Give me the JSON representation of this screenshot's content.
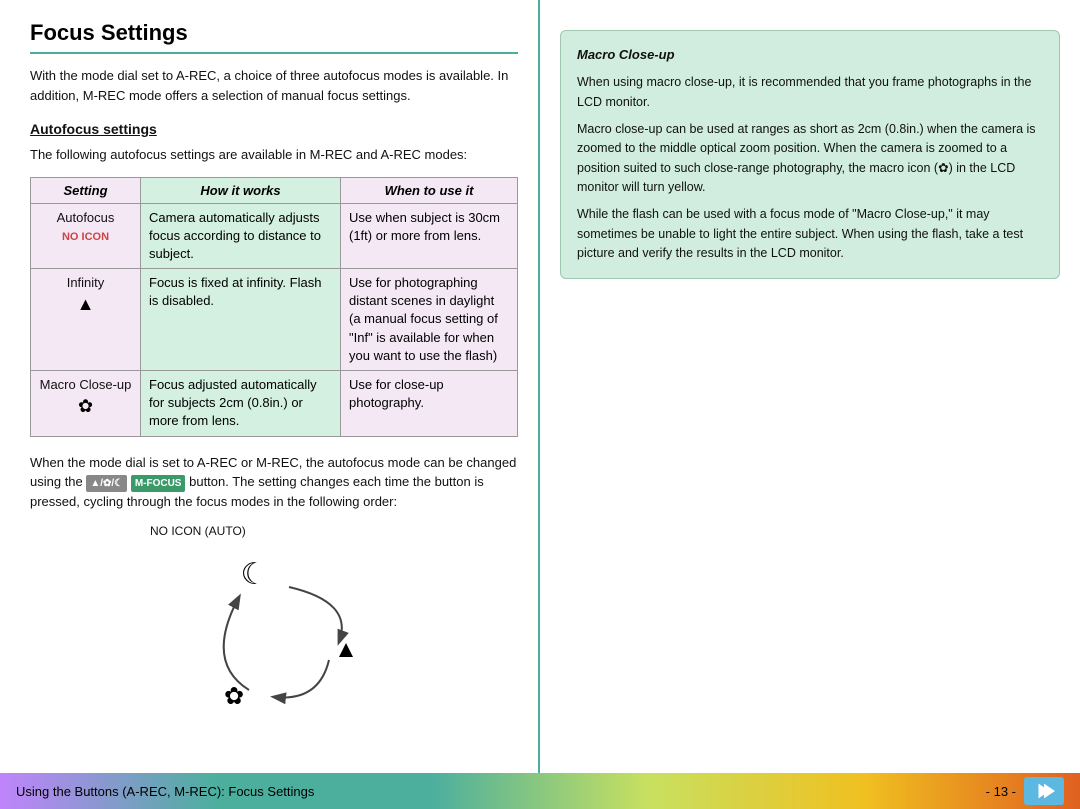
{
  "page": {
    "title": "Focus Settings",
    "intro": "With the mode dial set to A-REC, a choice of three autofocus modes is available.  In addition, M-REC mode offers a selection of manual focus settings.",
    "autofocus_section": {
      "heading": "Autofocus settings",
      "intro": "The following autofocus settings are available in M-REC and A-REC modes:"
    },
    "table": {
      "headers": [
        "Setting",
        "How it works",
        "When to use it"
      ],
      "rows": [
        {
          "setting_name": "Autofocus",
          "setting_icon": "NO ICON",
          "how": "Camera automatically adjusts focus according to distance to subject.",
          "when": "Use when subject is 30cm (1ft) or more from lens."
        },
        {
          "setting_name": "Infinity",
          "setting_icon": "mountain",
          "how": "Focus is fixed at infinity.  Flash is disabled.",
          "when": "Use for photographing distant scenes in daylight (a manual focus setting of \"Inf\" is available for when you want to use the flash)"
        },
        {
          "setting_name": "Macro Close-up",
          "setting_icon": "flower",
          "how": "Focus adjusted automatically for subjects 2cm (0.8in.) or more from lens.",
          "when": "Use for close-up photography."
        }
      ]
    },
    "bottom_left": {
      "text1": "When the mode dial is set to A-REC or M-REC, the autofocus mode can be changed using the ",
      "button_label": "M-FOCUS",
      "text2": " button.  The setting changes each time the button is pressed, cycling through the focus modes in the following order:",
      "cycle_label": "NO ICON (AUTO)"
    },
    "macro_box": {
      "title": "Macro Close-up",
      "para1": "When using macro close-up, it is recommended that you frame photographs in the LCD monitor.",
      "para2": "Macro close-up can be used at ranges as short as 2cm (0.8in.) when the camera is zoomed to the middle optical zoom position.  When the camera is zoomed to a position suited to such close-range photography, the macro icon (",
      "para2_icon": "flower",
      "para2_end": ") in the LCD monitor will turn yellow.",
      "para3": "While the flash can be used with a focus mode of \"Macro Close-up,\" it may sometimes be unable to light the entire subject.  When using the flash, take a test picture and verify the results in the LCD monitor."
    },
    "footer": {
      "text": "Using the Buttons (A-REC, M-REC): Focus Settings",
      "page_number": "- 13 -"
    }
  }
}
